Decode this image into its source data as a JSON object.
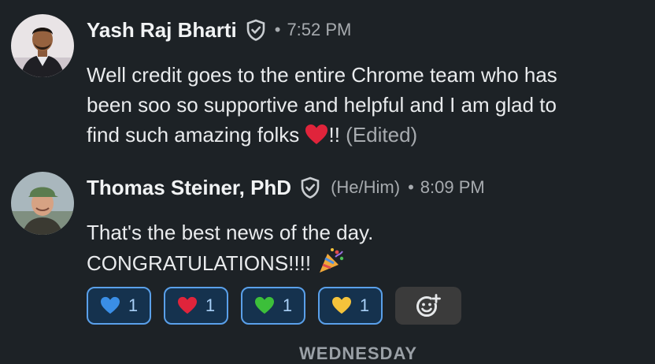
{
  "messages": [
    {
      "author": "Yash Raj Bharti",
      "pronouns": "",
      "separator": "•",
      "time": "7:52 PM",
      "text_lines": [
        "Well credit goes to the entire Chrome team who has",
        "been soo so supportive and helpful and I am glad to",
        "find such amazing folks"
      ],
      "after_emoji": "!!",
      "edited": "(Edited)"
    },
    {
      "author": "Thomas Steiner, PhD",
      "pronouns": "(He/Him)",
      "separator": "•",
      "time": "8:09 PM",
      "text_lines": [
        "That's the best news of the day.",
        "CONGRATULATIONS!!!!"
      ]
    }
  ],
  "reactions": [
    {
      "emoji": "blue-heart-icon",
      "count": "1",
      "color": "#3a8ee6"
    },
    {
      "emoji": "red-heart-icon",
      "count": "1",
      "color": "#e0243b"
    },
    {
      "emoji": "green-heart-icon",
      "count": "1",
      "color": "#3cbf3a"
    },
    {
      "emoji": "yellow-heart-icon",
      "count": "1",
      "color": "#f5c33b"
    }
  ],
  "date_divider": "WEDNESDAY",
  "colors": {
    "background": "#1d2226",
    "reaction_border": "#5aa0ea",
    "reaction_bg": "#15324e",
    "muted": "#a7abaf"
  }
}
